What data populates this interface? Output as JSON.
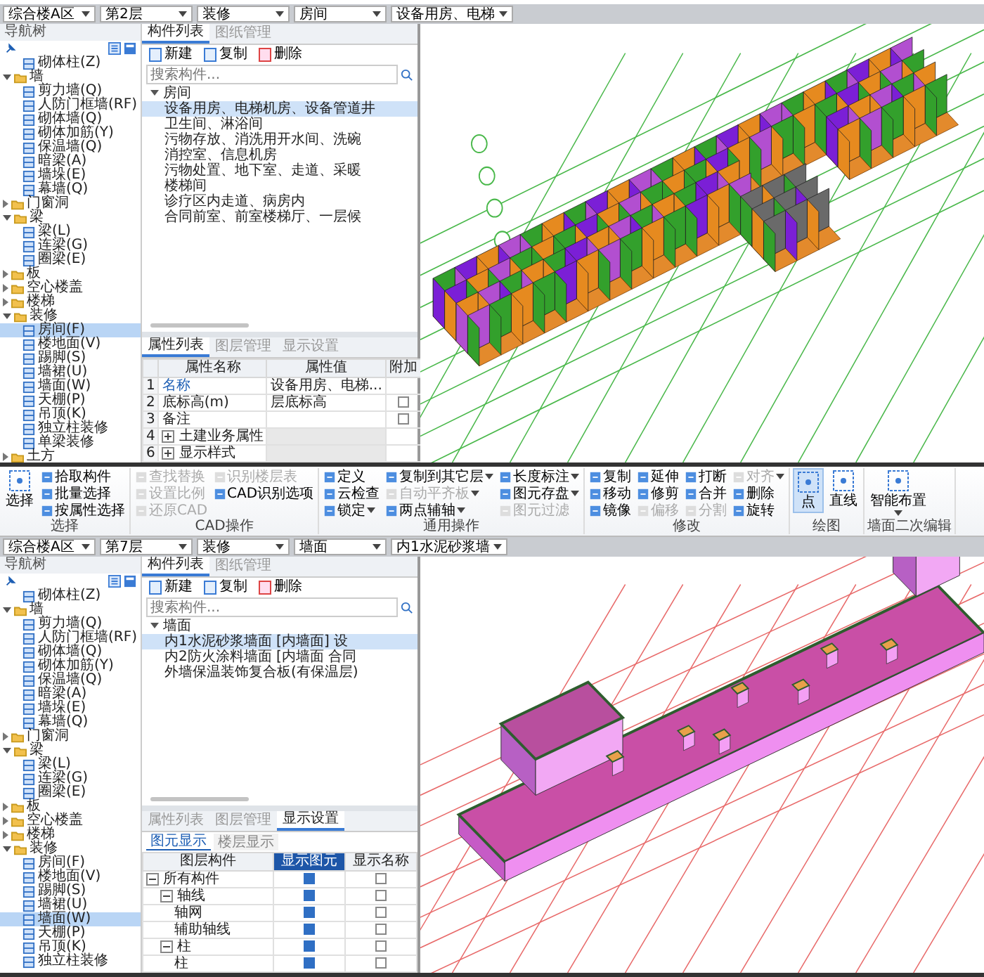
{
  "top_view": {
    "selectors": [
      {
        "value": "综合楼A区"
      },
      {
        "value": "第2层"
      },
      {
        "value": "装修"
      },
      {
        "value": "房间"
      },
      {
        "value": "设备用房、电梯"
      }
    ],
    "nav_tree": {
      "title": "导航树",
      "items": [
        {
          "label": "砌体柱(Z)",
          "kind": "item",
          "selected": false
        },
        {
          "label": "墙",
          "kind": "folder",
          "expanded": true,
          "selected": false,
          "children": [
            {
              "label": "剪力墙(Q)",
              "kind": "item",
              "selected": false
            },
            {
              "label": "人防门框墙(RF)",
              "kind": "item",
              "selected": false
            },
            {
              "label": "砌体墙(Q)",
              "kind": "item",
              "selected": false
            },
            {
              "label": "砌体加筋(Y)",
              "kind": "item",
              "selected": false
            },
            {
              "label": "保温墙(Q)",
              "kind": "item",
              "selected": false
            },
            {
              "label": "暗梁(A)",
              "kind": "item",
              "selected": false
            },
            {
              "label": "墙垛(E)",
              "kind": "item",
              "selected": false
            },
            {
              "label": "幕墙(Q)",
              "kind": "item",
              "selected": false
            }
          ]
        },
        {
          "label": "门窗洞",
          "kind": "folder",
          "expanded": false,
          "selected": false
        },
        {
          "label": "梁",
          "kind": "folder",
          "expanded": true,
          "selected": false,
          "children": [
            {
              "label": "梁(L)",
              "kind": "item",
              "selected": false
            },
            {
              "label": "连梁(G)",
              "kind": "item",
              "selected": false
            },
            {
              "label": "圈梁(E)",
              "kind": "item",
              "selected": false
            }
          ]
        },
        {
          "label": "板",
          "kind": "folder",
          "expanded": false,
          "selected": false
        },
        {
          "label": "空心楼盖",
          "kind": "folder",
          "expanded": false,
          "selected": false
        },
        {
          "label": "楼梯",
          "kind": "folder",
          "expanded": false,
          "selected": false
        },
        {
          "label": "装修",
          "kind": "folder",
          "expanded": true,
          "selected": false,
          "children": [
            {
              "label": "房间(F)",
              "kind": "item",
              "selected": true
            },
            {
              "label": "楼地面(V)",
              "kind": "item",
              "selected": false
            },
            {
              "label": "踢脚(S)",
              "kind": "item",
              "selected": false
            },
            {
              "label": "墙裙(U)",
              "kind": "item",
              "selected": false
            },
            {
              "label": "墙面(W)",
              "kind": "item",
              "selected": false
            },
            {
              "label": "天棚(P)",
              "kind": "item",
              "selected": false
            },
            {
              "label": "吊顶(K)",
              "kind": "item",
              "selected": false
            },
            {
              "label": "独立柱装修",
              "kind": "item",
              "selected": false
            },
            {
              "label": "单梁装修",
              "kind": "item",
              "selected": false
            }
          ]
        },
        {
          "label": "土方",
          "kind": "folder",
          "expanded": false,
          "selected": false
        }
      ]
    },
    "component_panel": {
      "tabs": [
        {
          "label": "构件列表",
          "selected": true
        },
        {
          "label": "图纸管理",
          "selected": false
        }
      ],
      "toolbar": [
        "新建",
        "复制",
        "删除"
      ],
      "search": {
        "placeholder": "搜索构件..."
      },
      "tree": {
        "label": "房间",
        "expanded": true,
        "children": [
          {
            "label": "设备用房、电梯机房、设备管道井",
            "selected": true
          },
          {
            "label": "卫生间、淋浴间",
            "selected": false
          },
          {
            "label": "污物存放、消洗用开水间、洗碗",
            "selected": false
          },
          {
            "label": "消控室、信息机房",
            "selected": false
          },
          {
            "label": "污物处置、地下室、走道、采暖",
            "selected": false
          },
          {
            "label": "楼梯间",
            "selected": false
          },
          {
            "label": "诊疗区内走道、病房内",
            "selected": false
          },
          {
            "label": "合同前室、前室楼梯厅、一层候",
            "selected": false
          }
        ]
      }
    },
    "property_panel": {
      "tabs": [
        {
          "label": "属性列表",
          "selected": true
        },
        {
          "label": "图层管理",
          "selected": false
        },
        {
          "label": "显示设置",
          "selected": false
        }
      ],
      "columns": [
        "属性名称",
        "属性值",
        "附加"
      ],
      "rows": [
        {
          "index": "1",
          "name": "名称",
          "value": "设备用房、电梯...",
          "kind": "prop",
          "highlight": true
        },
        {
          "index": "2",
          "name": "底标高(m)",
          "value": "层底标高",
          "kind": "prop",
          "highlight": false,
          "attach": false
        },
        {
          "index": "3",
          "name": "备注",
          "kind": "prop",
          "highlight": false,
          "attach": false
        },
        {
          "index": "4",
          "name": "土建业务属性",
          "kind": "group",
          "expanded": false
        },
        {
          "index": "6",
          "name": "显示样式",
          "kind": "group",
          "expanded": false
        }
      ]
    }
  },
  "ribbon": {
    "groups": [
      {
        "label": "选择",
        "columns": [
          [
            {
              "label": "选择",
              "kind": "large",
              "selected": false,
              "disabled": false,
              "dropdown": false
            }
          ],
          [
            {
              "label": "拾取构件",
              "kind": "small",
              "disabled": false,
              "dropdown": false
            },
            {
              "label": "批量选择",
              "kind": "small",
              "disabled": false,
              "dropdown": false
            },
            {
              "label": "按属性选择",
              "kind": "small",
              "disabled": false,
              "dropdown": false
            }
          ]
        ]
      },
      {
        "label": "CAD操作",
        "columns": [
          [
            {
              "label": "查找替换",
              "kind": "small",
              "disabled": true,
              "dropdown": false
            },
            {
              "label": "设置比例",
              "kind": "small",
              "disabled": true,
              "dropdown": false
            },
            {
              "label": "还原CAD",
              "kind": "small",
              "disabled": true,
              "dropdown": false
            }
          ],
          [
            {
              "label": "识别楼层表",
              "kind": "small",
              "disabled": true,
              "dropdown": false
            },
            {
              "label": "CAD识别选项",
              "kind": "small",
              "disabled": false,
              "dropdown": false
            }
          ]
        ]
      },
      {
        "label": "通用操作",
        "columns": [
          [
            {
              "label": "定义",
              "kind": "small",
              "disabled": false,
              "dropdown": false
            },
            {
              "label": "云检查",
              "kind": "small",
              "disabled": false,
              "dropdown": false
            },
            {
              "label": "锁定",
              "kind": "small",
              "disabled": false,
              "dropdown": true
            }
          ],
          [
            {
              "label": "复制到其它层",
              "kind": "small",
              "disabled": false,
              "dropdown": true
            },
            {
              "label": "自动平齐板",
              "kind": "small",
              "disabled": true,
              "dropdown": true
            },
            {
              "label": "两点辅轴",
              "kind": "small",
              "disabled": false,
              "dropdown": true
            }
          ],
          [
            {
              "label": "长度标注",
              "kind": "small",
              "disabled": false,
              "dropdown": true
            },
            {
              "label": "图元存盘",
              "kind": "small",
              "disabled": false,
              "dropdown": true
            },
            {
              "label": "图元过滤",
              "kind": "small",
              "disabled": true,
              "dropdown": false
            }
          ]
        ]
      },
      {
        "label": "修改",
        "columns": [
          [
            {
              "label": "复制",
              "kind": "small",
              "disabled": false,
              "dropdown": false
            },
            {
              "label": "移动",
              "kind": "small",
              "disabled": false,
              "dropdown": false
            },
            {
              "label": "镜像",
              "kind": "small",
              "disabled": false,
              "dropdown": false
            }
          ],
          [
            {
              "label": "延伸",
              "kind": "small",
              "disabled": false,
              "dropdown": false
            },
            {
              "label": "修剪",
              "kind": "small",
              "disabled": false,
              "dropdown": false
            },
            {
              "label": "偏移",
              "kind": "small",
              "disabled": true,
              "dropdown": false
            }
          ],
          [
            {
              "label": "打断",
              "kind": "small",
              "disabled": false,
              "dropdown": false
            },
            {
              "label": "合并",
              "kind": "small",
              "disabled": false,
              "dropdown": false
            },
            {
              "label": "分割",
              "kind": "small",
              "disabled": true,
              "dropdown": false
            }
          ],
          [
            {
              "label": "对齐",
              "kind": "small",
              "disabled": true,
              "dropdown": true
            },
            {
              "label": "删除",
              "kind": "small",
              "disabled": false,
              "dropdown": false
            },
            {
              "label": "旋转",
              "kind": "small",
              "disabled": false,
              "dropdown": false
            }
          ]
        ]
      },
      {
        "label": "绘图",
        "columns": [
          [
            {
              "label": "点",
              "kind": "large",
              "selected": true,
              "disabled": false,
              "dropdown": false
            }
          ],
          [
            {
              "label": "直线",
              "kind": "large",
              "selected": false,
              "disabled": false,
              "dropdown": false
            }
          ]
        ]
      },
      {
        "label": "墙面二次编辑",
        "columns": [
          [
            {
              "label": "智能布置",
              "kind": "large",
              "selected": false,
              "disabled": false,
              "dropdown": true
            }
          ]
        ]
      }
    ]
  },
  "bottom_view": {
    "selectors": [
      {
        "value": "综合楼A区"
      },
      {
        "value": "第7层"
      },
      {
        "value": "装修"
      },
      {
        "value": "墙面"
      },
      {
        "value": "内1水泥砂浆墙"
      }
    ],
    "nav_tree": {
      "title": "导航树",
      "items": [
        {
          "label": "砌体柱(Z)",
          "kind": "item",
          "selected": false
        },
        {
          "label": "墙",
          "kind": "folder",
          "expanded": true,
          "selected": false,
          "children": [
            {
              "label": "剪力墙(Q)",
              "kind": "item",
              "selected": false
            },
            {
              "label": "人防门框墙(RF)",
              "kind": "item",
              "selected": false
            },
            {
              "label": "砌体墙(Q)",
              "kind": "item",
              "selected": false
            },
            {
              "label": "砌体加筋(Y)",
              "kind": "item",
              "selected": false
            },
            {
              "label": "保温墙(Q)",
              "kind": "item",
              "selected": false
            },
            {
              "label": "暗梁(A)",
              "kind": "item",
              "selected": false
            },
            {
              "label": "墙垛(E)",
              "kind": "item",
              "selected": false
            },
            {
              "label": "幕墙(Q)",
              "kind": "item",
              "selected": false
            }
          ]
        },
        {
          "label": "门窗洞",
          "kind": "folder",
          "expanded": false,
          "selected": false
        },
        {
          "label": "梁",
          "kind": "folder",
          "expanded": true,
          "selected": false,
          "children": [
            {
              "label": "梁(L)",
              "kind": "item",
              "selected": false
            },
            {
              "label": "连梁(G)",
              "kind": "item",
              "selected": false
            },
            {
              "label": "圈梁(E)",
              "kind": "item",
              "selected": false
            }
          ]
        },
        {
          "label": "板",
          "kind": "folder",
          "expanded": false,
          "selected": false
        },
        {
          "label": "空心楼盖",
          "kind": "folder",
          "expanded": false,
          "selected": false
        },
        {
          "label": "楼梯",
          "kind": "folder",
          "expanded": false,
          "selected": false
        },
        {
          "label": "装修",
          "kind": "folder",
          "expanded": true,
          "selected": false,
          "children": [
            {
              "label": "房间(F)",
              "kind": "item",
              "selected": false
            },
            {
              "label": "楼地面(V)",
              "kind": "item",
              "selected": false
            },
            {
              "label": "踢脚(S)",
              "kind": "item",
              "selected": false
            },
            {
              "label": "墙裙(U)",
              "kind": "item",
              "selected": false
            },
            {
              "label": "墙面(W)",
              "kind": "item",
              "selected": true
            },
            {
              "label": "天棚(P)",
              "kind": "item",
              "selected": false
            },
            {
              "label": "吊顶(K)",
              "kind": "item",
              "selected": false
            },
            {
              "label": "独立柱装修",
              "kind": "item",
              "selected": false
            }
          ]
        }
      ]
    },
    "component_panel": {
      "tabs": [
        {
          "label": "构件列表",
          "selected": true
        },
        {
          "label": "图纸管理",
          "selected": false
        }
      ],
      "toolbar": [
        "新建",
        "复制",
        "删除"
      ],
      "search": {
        "placeholder": "搜索构件..."
      },
      "tree": {
        "label": "墙面",
        "expanded": true,
        "children": [
          {
            "label": "内1水泥砂浆墙面 [内墙面] 设",
            "selected": true
          },
          {
            "label": "内2防火涂料墙面 [内墙面 合同",
            "selected": false
          },
          {
            "label": "外墙保温装饰复合板(有保温层)",
            "selected": false
          }
        ]
      }
    },
    "display_panel": {
      "tabs": [
        {
          "label": "属性列表",
          "selected": false
        },
        {
          "label": "图层管理",
          "selected": false
        },
        {
          "label": "显示设置",
          "selected": true
        }
      ],
      "subtabs": [
        {
          "label": "图元显示",
          "selected": true
        },
        {
          "label": "楼层显示",
          "selected": false
        }
      ],
      "columns": [
        "图层构件",
        "显示图元",
        "显示名称"
      ],
      "rows": [
        {
          "label": "所有构件",
          "expanded": true,
          "show": true,
          "show_name": false,
          "children": [
            {
              "label": "轴线",
              "expanded": true,
              "show": true,
              "show_name": false,
              "children": [
                {
                  "label": "轴网",
                  "show": true,
                  "show_name": false
                },
                {
                  "label": "辅助轴线",
                  "show": true,
                  "show_name": false
                }
              ]
            },
            {
              "label": "柱",
              "expanded": true,
              "show": true,
              "show_name": false,
              "children": [
                {
                  "label": "柱",
                  "show": true,
                  "show_name": false
                }
              ]
            }
          ]
        }
      ]
    }
  }
}
